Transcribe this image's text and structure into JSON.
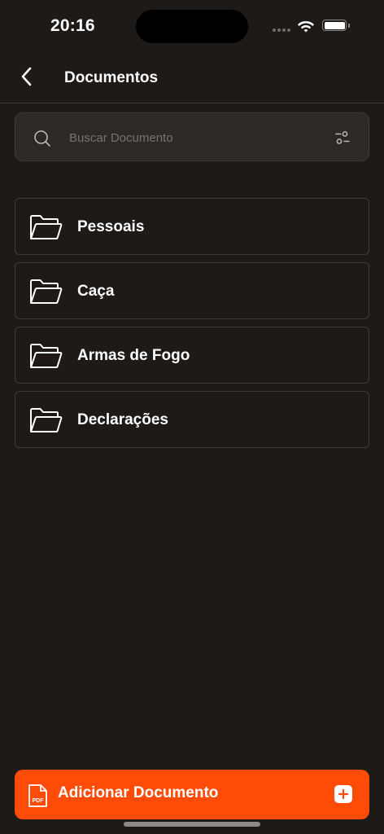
{
  "status_bar": {
    "time": "20:16"
  },
  "header": {
    "title": "Documentos",
    "back_icon": "chevron-left-icon"
  },
  "search": {
    "placeholder": "Buscar Documento",
    "value": "",
    "icon": "search-icon",
    "filter_icon": "sliders-icon"
  },
  "folders": [
    {
      "label": "Pessoais",
      "icon": "folder-open-icon"
    },
    {
      "label": "Caça",
      "icon": "folder-open-icon"
    },
    {
      "label": "Armas de Fogo",
      "icon": "folder-open-icon"
    },
    {
      "label": "Declarações",
      "icon": "folder-open-icon"
    }
  ],
  "add_button": {
    "label": "Adicionar Documento",
    "pdf_icon_text": "PDF",
    "color": "#fe4c08"
  },
  "colors": {
    "background": "#1d1a18",
    "accent": "#fe4c08",
    "border": "#3f3b38"
  }
}
